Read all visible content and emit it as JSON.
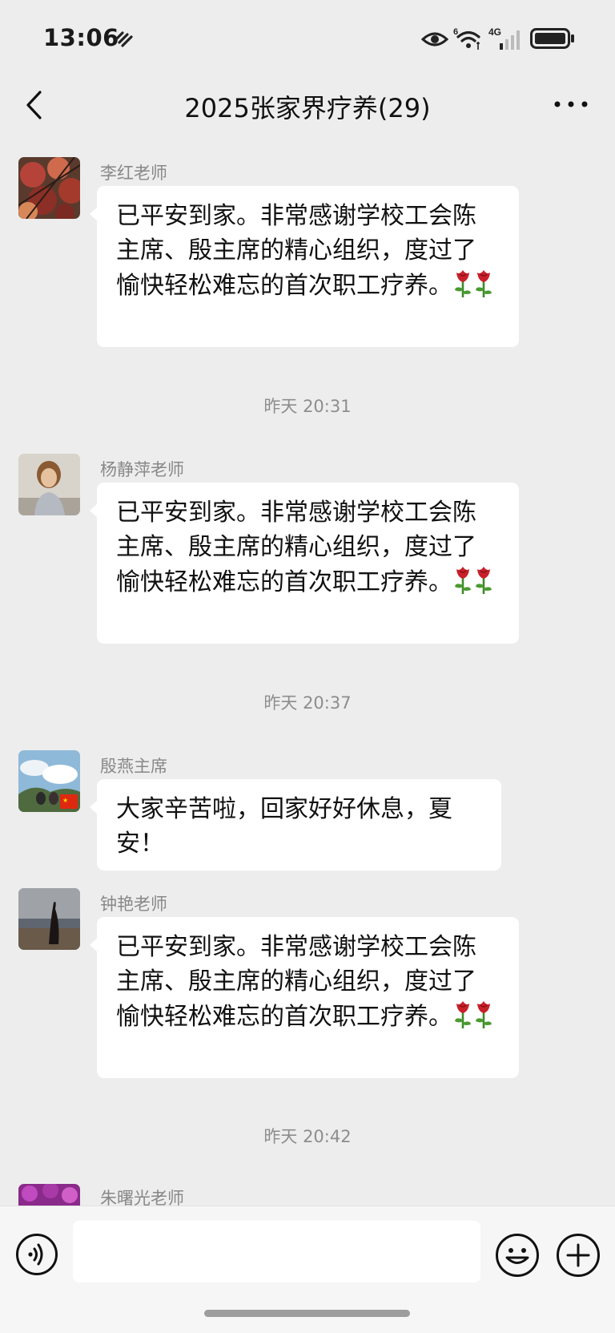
{
  "status_bar": {
    "time": "13:06",
    "network": "4G",
    "sim_label": "6"
  },
  "header": {
    "title": "2025张家界疗养(29)"
  },
  "messages": [
    {
      "sender": "李红老师",
      "text": "已平安到家。非常感谢学校工会陈主席、殷主席的精心组织，度过了愉快轻松难忘的首次职工疗养。",
      "emoji": [
        "rose",
        "rose"
      ]
    },
    {
      "timestamp": "昨天 20:31"
    },
    {
      "sender": "杨静萍老师",
      "text": "已平安到家。非常感谢学校工会陈主席、殷主席的精心组织，度过了愉快轻松难忘的首次职工疗养。",
      "emoji": [
        "rose",
        "rose"
      ]
    },
    {
      "timestamp": "昨天 20:37"
    },
    {
      "sender": "殷燕主席",
      "text": "大家辛苦啦，回家好好休息，夏安！"
    },
    {
      "sender": "钟艳老师",
      "text": "已平安到家。非常感谢学校工会陈主席、殷主席的精心组织，度过了愉快轻松难忘的首次职工疗养。",
      "emoji": [
        "rose",
        "rose"
      ]
    },
    {
      "timestamp": "昨天 20:42"
    },
    {
      "sender": "朱曙光老师"
    }
  ],
  "input_bar": {
    "value": "",
    "placeholder": ""
  },
  "colors": {
    "background": "#ededed",
    "bubble": "#ffffff",
    "meta_text": "#888888"
  }
}
